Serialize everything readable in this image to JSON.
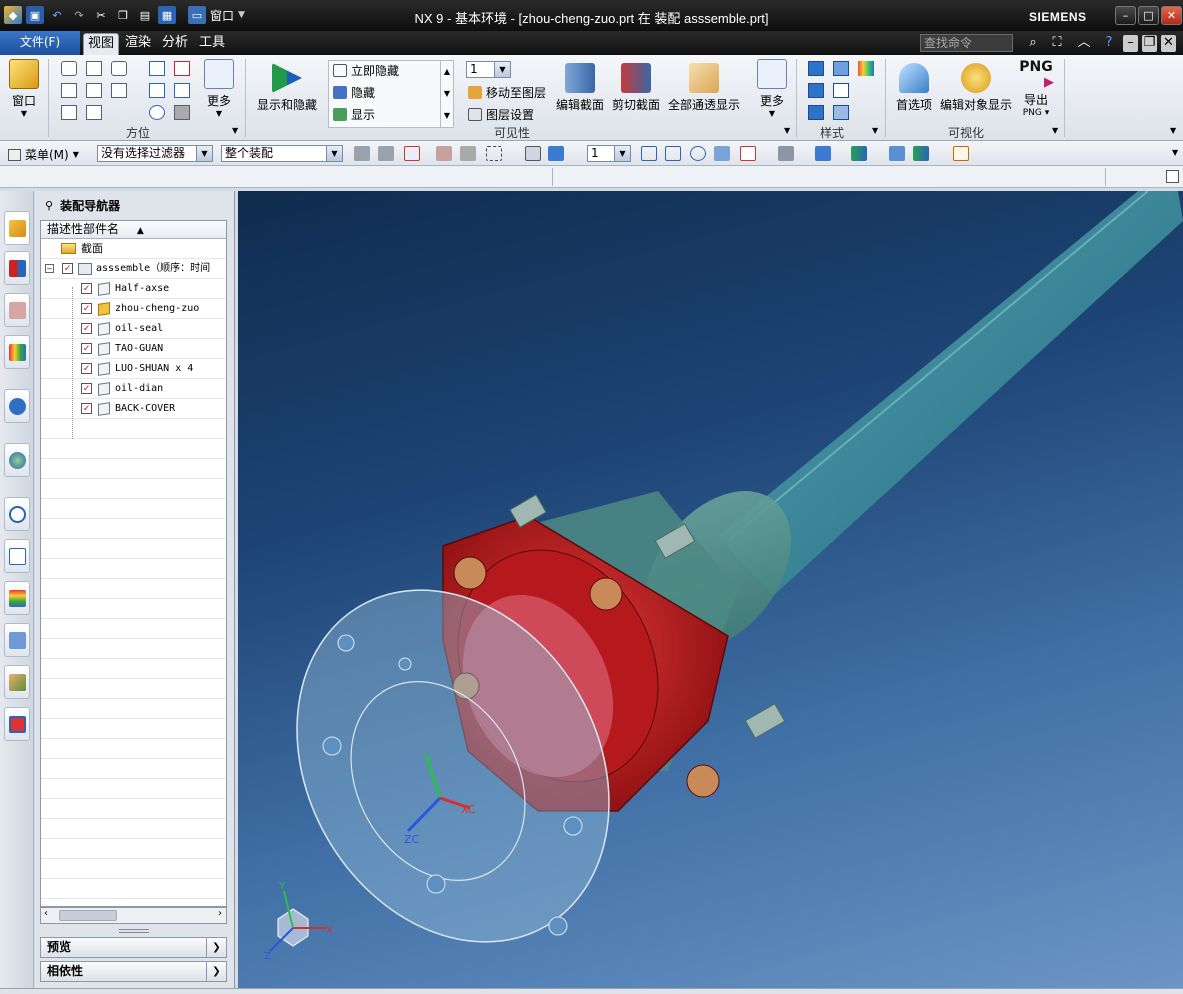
{
  "window": {
    "title": "NX 9 - 基本环境 - [zhou-cheng-zuo.prt 在 装配 asssemble.prt]",
    "brand": "SIEMENS",
    "qat_window_label": "窗口"
  },
  "tabs": {
    "file": "文件(F)",
    "items": [
      "视图",
      "渲染",
      "分析",
      "工具"
    ],
    "active": "视图"
  },
  "command_search": {
    "placeholder": "查找命令"
  },
  "ribbon": {
    "groups": {
      "window_btn": "窗口",
      "orient_more": "更多",
      "orient_label": "方位",
      "show_hide_btn": "显示和隐藏",
      "immediate_hide": "立即隐藏",
      "hide": "隐藏",
      "show": "显示",
      "layer_value": "1",
      "move_to_layer": "移动至图层",
      "layer_settings": "图层设置",
      "edit_section": "编辑截面",
      "clip_section": "剪切截面",
      "all_translucent": "全部通透显示",
      "visibility_more": "更多",
      "visibility_label": "可见性",
      "style_label": "样式",
      "prefs": "首选项",
      "edit_obj_display": "编辑对象显示",
      "export_png_icon": "PNG",
      "export": "导出",
      "export_sub": "PNG",
      "visualize_label": "可视化"
    }
  },
  "toolbar": {
    "menu": "菜单(M)",
    "filter": "没有选择过滤器",
    "scope": "整个装配",
    "layer": "1"
  },
  "navigator": {
    "title": "装配导航器",
    "column_header": "描述性部件名",
    "rows": [
      {
        "label": "截面",
        "kind": "folder"
      },
      {
        "label": "asssemble（顺序：时间",
        "kind": "assembly"
      },
      {
        "label": "Half-axse",
        "kind": "part"
      },
      {
        "label": "zhou-cheng-zuo",
        "kind": "work-part"
      },
      {
        "label": "oil-seal",
        "kind": "part"
      },
      {
        "label": "TAO-GUAN",
        "kind": "part"
      },
      {
        "label": "LUO-SHUAN x 4",
        "kind": "part"
      },
      {
        "label": "oil-dian",
        "kind": "part"
      },
      {
        "label": "BACK-COVER",
        "kind": "part"
      }
    ],
    "preview_panel": "预览",
    "dependency_panel": "相依性"
  },
  "viewport": {
    "wcs_label": "ZC",
    "xc_label": "XC",
    "triad_x": "X",
    "triad_y": "Y",
    "triad_z": "Z"
  },
  "colors": {
    "flange_red": "#c8171c",
    "housing_teal": "#4f8d86",
    "shaft_teal": "#2a7c8c",
    "background_top": "#0f2c4e",
    "background_bottom": "#6b95c6"
  }
}
